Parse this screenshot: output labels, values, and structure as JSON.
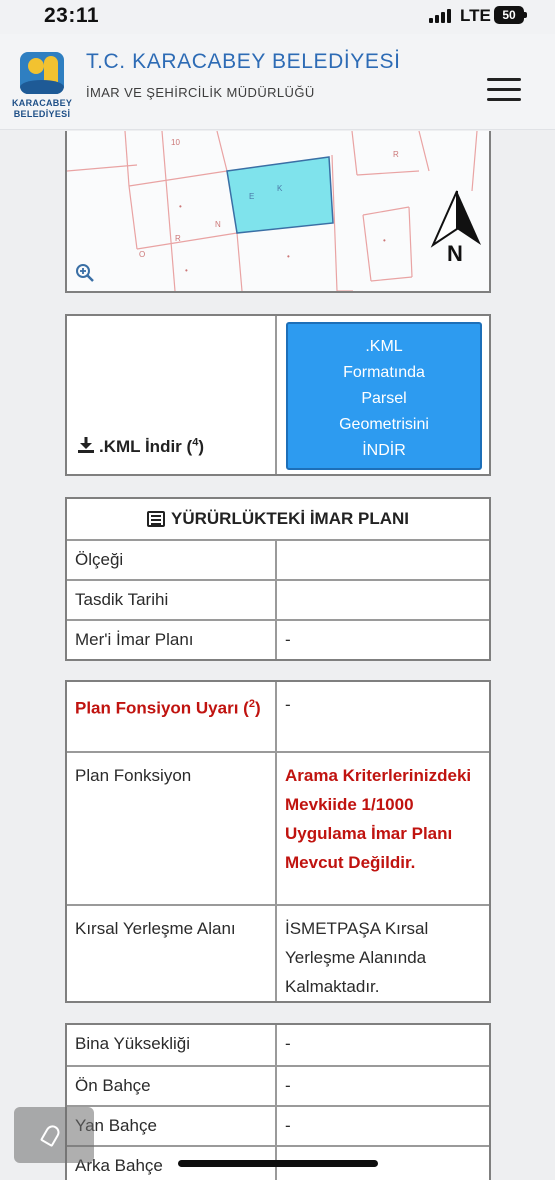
{
  "status_bar": {
    "time": "23:11",
    "network": "LTE",
    "battery": "50"
  },
  "header": {
    "logo_line1": "KARACABEY",
    "logo_line2": "BELEDİYESİ",
    "title": "T.C. KARACABEY BELEDİYESİ",
    "subtitle": "İMAR VE ŞEHİRCİLİK MÜDÜRLÜĞÜ",
    "menu_icon": "hamburger-menu-icon"
  },
  "map": {
    "north_label": "N",
    "zoom_icon": "magnify-plus-icon",
    "parcel_color": "#7fe3ec"
  },
  "kml": {
    "download_label": ".KML İndir",
    "download_sup": "4",
    "button_lines": [
      ".KML",
      "Formatında",
      "Parsel",
      "Geometrisini",
      "İNDİR"
    ]
  },
  "plan_table": {
    "title": "YÜRÜRLÜKTEKİ İMAR PLANI",
    "rows": [
      {
        "label": "Ölçeği",
        "value": ""
      },
      {
        "label": "Tasdik Tarihi",
        "value": ""
      },
      {
        "label": "Mer'i İmar Planı",
        "value": "-"
      }
    ]
  },
  "function_table": {
    "warning_label": "Plan Fonsiyon Uyarı",
    "warning_sup": "2",
    "warning_value": "-",
    "function_label": "Plan Fonksiyon",
    "function_value": "Arama Kriterlerinizdeki Mevkiide 1/1000 Uygulama İmar Planı Mevcut Değildir.",
    "rural_label": "Kırsal Yerleşme Alanı",
    "rural_value": "İSMETPAŞA Kırsal Yerleşme Alanında Kalmaktadır."
  },
  "build_table": {
    "rows": [
      {
        "label": "Bina Yüksekliği",
        "value": "-"
      },
      {
        "label": "Ön Bahçe",
        "value": "-"
      },
      {
        "label": "Yan Bahçe",
        "value": "-"
      },
      {
        "label": "Arka Bahçe",
        "value": ""
      }
    ]
  },
  "colors": {
    "accent": "#2d6bb5",
    "button": "#2d9bf0",
    "warning": "#c0130f"
  }
}
